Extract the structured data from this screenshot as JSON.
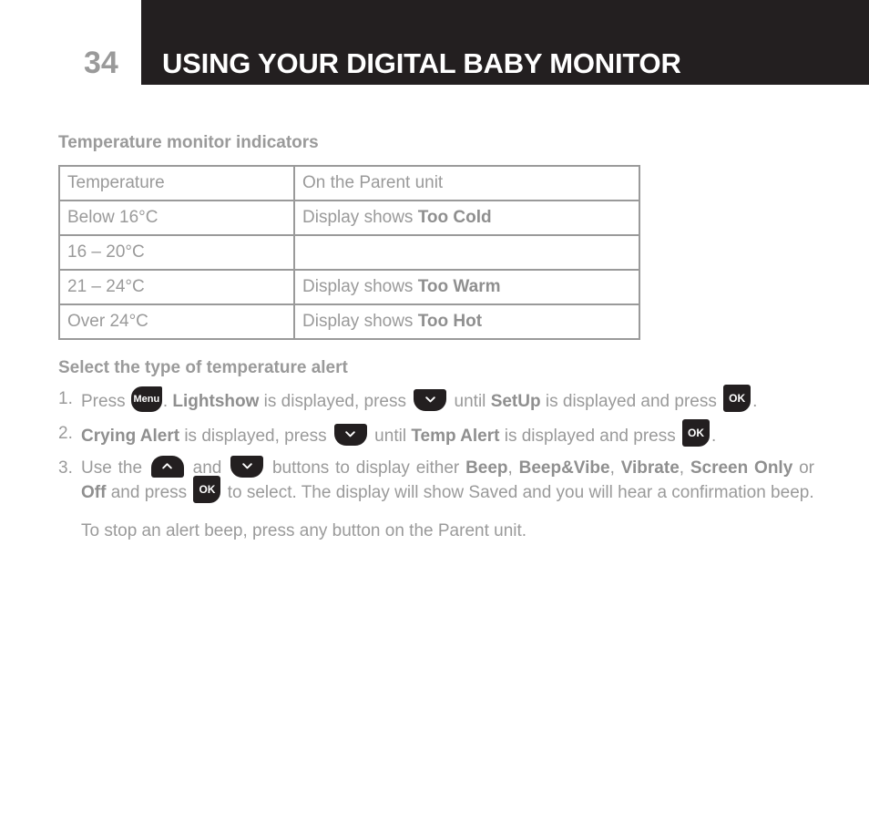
{
  "header": {
    "page_number": "34",
    "title": "USING YOUR DIGITAL BABY MONITOR",
    "bar_color": "#231f20",
    "title_color": "#ffffff",
    "page_number_color": "#9a9a9a"
  },
  "sections": {
    "temperature_indicators": {
      "heading": "Temperature monitor indicators",
      "table": {
        "columns": [
          "Temperature",
          "On the Parent unit"
        ],
        "rows": [
          {
            "temperature": "Below 16°C",
            "prefix": "Display shows ",
            "status": "Too Cold"
          },
          {
            "temperature": "16 – 20°C",
            "prefix": "",
            "status": ""
          },
          {
            "temperature": "21 – 24°C",
            "prefix": "Display shows ",
            "status": "Too Warm"
          },
          {
            "temperature": "Over 24°C",
            "prefix": "Display shows ",
            "status": "Too Hot"
          }
        ]
      }
    },
    "temperature_alert": {
      "heading": "Select the type of temperature alert",
      "steps": [
        {
          "number": "1.",
          "t1": "Press ",
          "key1": "Menu",
          "t2": ". ",
          "b1": "Lightshow",
          "t3": " is displayed, press ",
          "key2": "chevron-down",
          "t4": " until ",
          "b2": "SetUp",
          "t5": " is displayed and press ",
          "key3": "OK",
          "t6": "."
        },
        {
          "number": "2.",
          "b1": "Crying Alert",
          "t1": " is displayed, press ",
          "key1": "chevron-down",
          "t2": " until ",
          "b2": "Temp Alert",
          "t3": " is displayed and press ",
          "key2": "OK",
          "t4": "."
        },
        {
          "number": "3.",
          "t1": "Use the ",
          "key1": "chevron-up",
          "t2": " and ",
          "key2": "chevron-down",
          "t3": " buttons to display either ",
          "b1": "Beep",
          "t4": ", ",
          "b2": "Beep&Vibe",
          "t5": ", ",
          "b3": "Vibrate",
          "t6": ", ",
          "b4": "Screen Only",
          "t7": " or ",
          "b5": "Off",
          "t8": " and press ",
          "key3": "OK",
          "t9": " to select. The display will show Saved and you will hear a confirmation beep."
        }
      ],
      "note": "To stop an alert beep, press any button on the Parent unit."
    }
  },
  "keys": {
    "menu_label": "Menu",
    "ok_label": "OK"
  },
  "colors": {
    "body_text": "#9a9a9a",
    "bold_text": "#8f8f8f",
    "key_background": "#231f20",
    "table_border": "#9a9a9a"
  }
}
